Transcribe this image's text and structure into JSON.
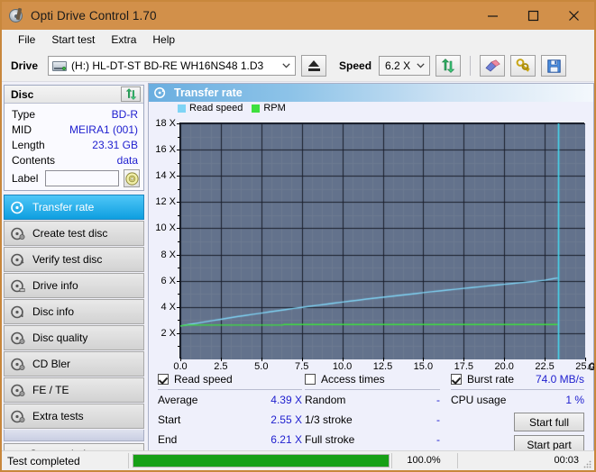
{
  "window": {
    "title": "Opti Drive Control 1.70",
    "icon": "disc-drive-icon",
    "titlebar_color": "#d2904a",
    "minimize": "minimize-icon",
    "maximize": "maximize-icon",
    "close": "close-icon"
  },
  "menu": {
    "items": [
      {
        "label": "File"
      },
      {
        "label": "Start test"
      },
      {
        "label": "Extra"
      },
      {
        "label": "Help"
      }
    ]
  },
  "toolbar": {
    "drive_label": "Drive",
    "drive_value": "(H:)  HL-DT-ST BD-RE  WH16NS48 1.D3",
    "eject_icon": "eject-icon",
    "speed_label": "Speed",
    "speed_value": "6.2 X",
    "refresh_icon": "refresh-icon",
    "eraser_icon": "eraser-icon",
    "keys_icon": "keys-icon",
    "save_icon": "save-icon"
  },
  "disc_panel": {
    "title": "Disc",
    "refresh_icon": "refresh-icon",
    "rows": [
      {
        "key": "Type",
        "value": "BD-R"
      },
      {
        "key": "MID",
        "value": "MEIRA1 (001)"
      },
      {
        "key": "Length",
        "value": "23.31 GB"
      },
      {
        "key": "Contents",
        "value": "data"
      }
    ],
    "label_key": "Label",
    "label_value": "",
    "label_placeholder": "",
    "disc_button_icon": "disc-icon"
  },
  "nav": {
    "items": [
      {
        "label": "Transfer rate",
        "icon": "disc-test-icon",
        "active": true
      },
      {
        "label": "Create test disc",
        "icon": "disc-write-icon",
        "active": false
      },
      {
        "label": "Verify test disc",
        "icon": "disc-verify-icon",
        "active": false
      },
      {
        "label": "Drive info",
        "icon": "disc-drive-icon",
        "active": false
      },
      {
        "label": "Disc info",
        "icon": "disc-info-icon",
        "active": false
      },
      {
        "label": "Disc quality",
        "icon": "disc-quality-icon",
        "active": false
      },
      {
        "label": "CD Bler",
        "icon": "disc-bler-icon",
        "active": false
      },
      {
        "label": "FE / TE",
        "icon": "disc-fete-icon",
        "active": false
      },
      {
        "label": "Extra tests",
        "icon": "disc-extra-icon",
        "active": false
      }
    ],
    "status_window": "Status window > >"
  },
  "chart_panel": {
    "title": "Transfer rate",
    "icon": "disc-test-icon"
  },
  "chart_data": {
    "type": "line",
    "title": "Transfer rate",
    "xlabel": "GB",
    "ylabel": "X",
    "xlim": [
      0,
      25
    ],
    "ylim": [
      0,
      18
    ],
    "xticks": [
      0.0,
      2.5,
      5.0,
      7.5,
      10.0,
      12.5,
      15.0,
      17.5,
      20.0,
      22.5,
      25.0
    ],
    "xtick_labels": [
      "0.0",
      "2.5",
      "5.0",
      "7.5",
      "10.0",
      "12.5",
      "15.0",
      "17.5",
      "20.0",
      "22.5",
      "25.0"
    ],
    "x_unit_label": "GB",
    "yticks": [
      2,
      4,
      6,
      8,
      10,
      12,
      14,
      16,
      18
    ],
    "ytick_labels": [
      "2 X",
      "4 X",
      "6 X",
      "8 X",
      "10 X",
      "12 X",
      "14 X",
      "16 X",
      "18 X"
    ],
    "grid": true,
    "plot_bg": "#63728c",
    "legend_position": "top-left",
    "legend": [
      {
        "name": "Read speed",
        "color": "#7fd4f5"
      },
      {
        "name": "RPM",
        "color": "#3ee03e"
      }
    ],
    "series": [
      {
        "name": "Read speed",
        "color": "#7fd4f5",
        "x": [
          0.0,
          0.5,
          1.0,
          1.5,
          2.0,
          2.5,
          3.0,
          3.5,
          4.0,
          4.5,
          5.0,
          5.5,
          6.0,
          6.5,
          7.0,
          7.5,
          8.0,
          8.5,
          9.0,
          9.5,
          10.0,
          10.5,
          11.0,
          11.5,
          12.0,
          12.5,
          13.0,
          13.5,
          14.0,
          14.5,
          15.0,
          15.5,
          16.0,
          16.5,
          17.0,
          17.5,
          18.0,
          18.5,
          19.0,
          19.5,
          20.0,
          20.5,
          21.0,
          21.5,
          22.0,
          22.5,
          23.0,
          23.31
        ],
        "y": [
          2.55,
          2.66,
          2.76,
          2.86,
          2.96,
          3.06,
          3.16,
          3.26,
          3.35,
          3.44,
          3.53,
          3.62,
          3.71,
          3.8,
          3.89,
          3.97,
          4.05,
          4.13,
          4.21,
          4.29,
          4.37,
          4.45,
          4.52,
          4.6,
          4.67,
          4.74,
          4.81,
          4.88,
          4.95,
          5.02,
          5.09,
          5.16,
          5.22,
          5.29,
          5.35,
          5.42,
          5.48,
          5.54,
          5.61,
          5.67,
          5.73,
          5.79,
          5.85,
          5.91,
          5.97,
          6.04,
          6.15,
          6.21
        ]
      },
      {
        "name": "RPM",
        "color": "#3ee03e",
        "x": [
          0.0,
          0.4,
          6.3,
          6.4,
          23.31
        ],
        "y": [
          2.55,
          2.62,
          2.62,
          2.66,
          2.66
        ]
      }
    ],
    "markers": [
      {
        "name": "end-marker",
        "type": "vline",
        "x": 23.31,
        "color": "#45d8f0"
      }
    ]
  },
  "results": {
    "read_speed": {
      "checkbox_label": "Read speed",
      "checked": true,
      "rows": [
        {
          "key": "Average",
          "value": "4.39 X"
        },
        {
          "key": "Start",
          "value": "2.55 X"
        },
        {
          "key": "End",
          "value": "6.21 X"
        }
      ]
    },
    "access_times": {
      "checkbox_label": "Access times",
      "checked": false,
      "rows": [
        {
          "key": "Random",
          "value": "-"
        },
        {
          "key": "1/3 stroke",
          "value": "-"
        },
        {
          "key": "Full stroke",
          "value": "-"
        }
      ]
    },
    "burst_rate": {
      "checkbox_label": "Burst rate",
      "checked": true,
      "value": "74.0 MB/s",
      "rows": [
        {
          "key": "CPU usage",
          "value": "1 %"
        }
      ]
    },
    "buttons": [
      {
        "label": "Start full"
      },
      {
        "label": "Start part"
      }
    ]
  },
  "statusbar": {
    "text": "Test completed",
    "progress_percent": 100.0,
    "progress_label": "100.0%",
    "elapsed": "00:03",
    "progress_color": "#17a016"
  }
}
